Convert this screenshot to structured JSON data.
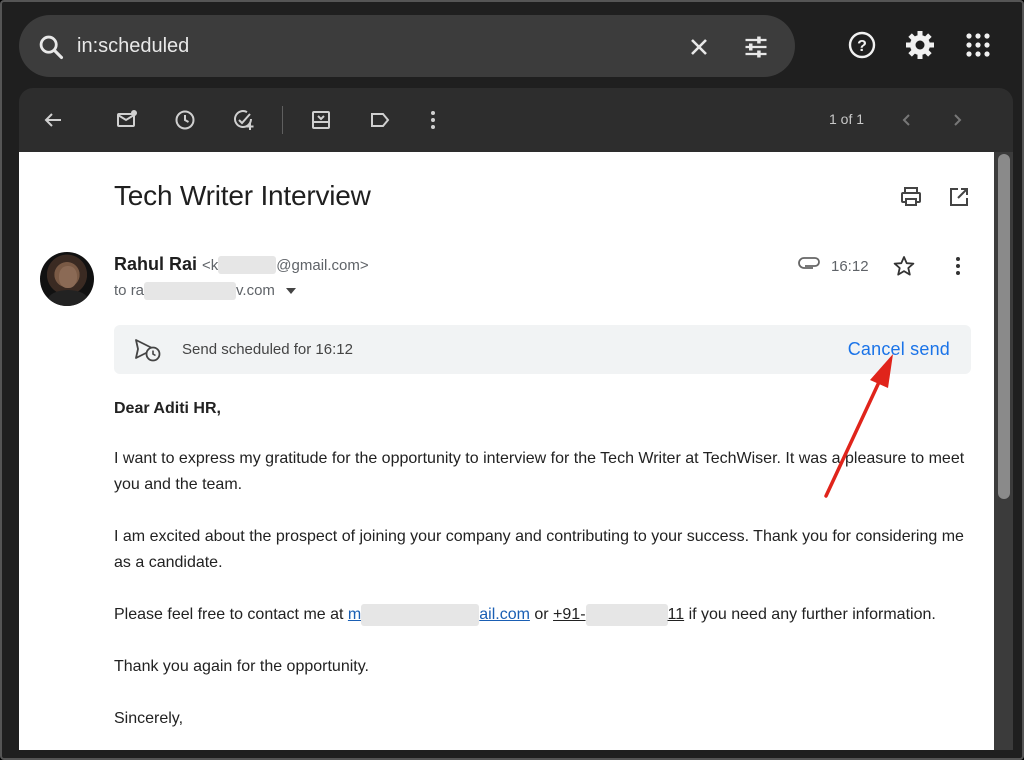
{
  "search": {
    "query": "in:scheduled"
  },
  "toolbar": {
    "pager": "1 of 1"
  },
  "email": {
    "subject": "Tech Writer Interview",
    "sender_name": "Rahul Rai",
    "sender_email_start": "<k",
    "sender_email_end": "@gmail.com>",
    "to_prefix": "to ",
    "to_start": "ra",
    "to_end": "v.com",
    "time": "16:12",
    "banner_text": "Send scheduled for 16:12",
    "cancel_label": "Cancel send",
    "greeting": "Dear Aditi HR,",
    "para1": "I want to express my gratitude for the opportunity to interview for the Tech Writer at TechWiser. It was a pleasure to meet you and the team.",
    "para2": "I am excited about the prospect of joining your company and contributing to your success. Thank you for considering me as a candidate.",
    "para3_start": "Please feel free to contact me at ",
    "email_link_start": "m",
    "email_link_end": "ail.com",
    "para3_or": " or ",
    "phone_start": "+91-",
    "phone_end": "11",
    "para3_end": " if you need any further information.",
    "para4": "Thank you again for the opportunity.",
    "closing": "Sincerely,"
  },
  "icons": {
    "search": "search-icon",
    "clear": "close-icon",
    "filters": "tune-icon",
    "help": "help-icon",
    "settings": "gear-icon",
    "apps": "apps-grid-icon",
    "back": "arrow-left-icon",
    "mark_unread": "mark-unread-icon",
    "snooze": "clock-icon",
    "add_task": "add-task-icon",
    "move": "move-to-icon",
    "label": "label-icon",
    "more": "more-vert-icon",
    "prev": "chevron-left-icon",
    "next": "chevron-right-icon",
    "print": "print-icon",
    "open_new": "open-in-new-icon",
    "attachment": "paperclip-icon",
    "star": "star-icon",
    "scheduled": "scheduled-send-icon",
    "arrow": "red-arrow-annotation"
  },
  "colors": {
    "accent": "#1a73e8",
    "annotation": "#e0241b"
  }
}
